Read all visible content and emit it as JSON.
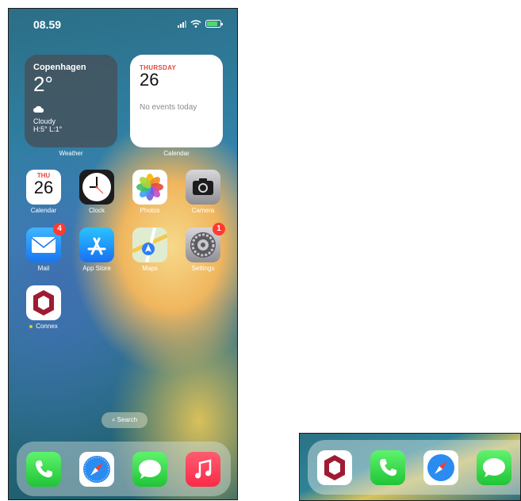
{
  "status_bar": {
    "time": "08.59"
  },
  "widgets": {
    "weather": {
      "city": "Copenhagen",
      "temp": "2°",
      "condition": "Cloudy",
      "high_low": "H:5° L:1°",
      "label": "Weather"
    },
    "calendar": {
      "day": "THURSDAY",
      "date": "26",
      "events": "No events today",
      "label": "Calendar"
    }
  },
  "apps": {
    "calendar": {
      "label": "Calendar",
      "day": "THU",
      "date": "26"
    },
    "clock": {
      "label": "Clock"
    },
    "photos": {
      "label": "Photos"
    },
    "camera": {
      "label": "Camera"
    },
    "mail": {
      "label": "Mail",
      "badge": "4"
    },
    "app_store": {
      "label": "App Store"
    },
    "maps": {
      "label": "Maps"
    },
    "settings": {
      "label": "Settings",
      "badge": "1"
    },
    "connex": {
      "label": "Connex"
    }
  },
  "search": {
    "label": "Search"
  },
  "dock": [
    "phone-icon",
    "safari-icon",
    "messages-icon",
    "music-icon"
  ],
  "snippet_dock": [
    "connex-icon",
    "phone-icon",
    "safari-icon",
    "messages-icon"
  ]
}
